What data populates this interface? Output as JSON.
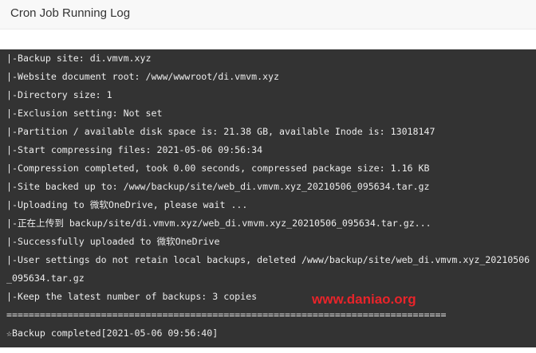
{
  "window": {
    "title": "Cron Job Running Log"
  },
  "log": {
    "lines": [
      "|-Backup site: di.vmvm.xyz",
      "|-Website document root: /www/wwwroot/di.vmvm.xyz",
      "|-Directory size: 1",
      "|-Exclusion setting: Not set",
      "|-Partition / available disk space is: 21.38 GB, available Inode is: 13018147",
      "|-Start compressing files: 2021-05-06 09:56:34",
      "|-Compression completed, took 0.00 seconds, compressed package size: 1.16 KB",
      "|-Site backed up to: /www/backup/site/web_di.vmvm.xyz_20210506_095634.tar.gz",
      "|-Uploading to 微软OneDrive, please wait ...",
      "|-正在上传到 backup/site/di.vmvm.xyz/web_di.vmvm.xyz_20210506_095634.tar.gz...",
      "|-Successfully uploaded to 微软OneDrive",
      "|-User settings do not retain local backups, deleted /www/backup/site/web_di.vmvm.xyz_20210506_095634.tar.gz",
      "|-Keep the latest number of backups: 3 copies",
      "===============================================================================",
      "☆Backup completed[2021-05-06 09:56:40]"
    ]
  },
  "watermark": {
    "text": "www.daniao.org",
    "color": "#e8242a"
  },
  "colors": {
    "console_background": "#333333",
    "console_text": "#ececec",
    "header_background": "#f8f8f8"
  }
}
